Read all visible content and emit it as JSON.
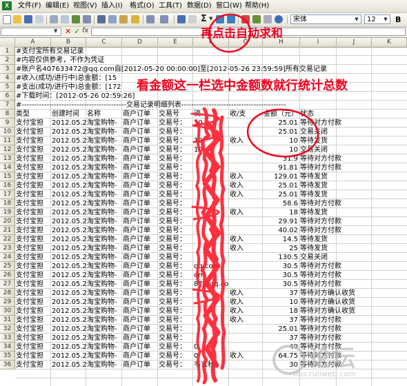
{
  "menu": {
    "items": [
      "文件(F)",
      "编辑(E)",
      "视图(V)",
      "插入(I)",
      "格式(O)",
      "工具(T)",
      "数据(D)",
      "窗口(W)",
      "帮助(H)"
    ]
  },
  "toolbar": {
    "sum_label": "Σ",
    "font_name": "宋体",
    "font_size": "12",
    "bold_label": "B"
  },
  "formula_bar": {
    "name_box": "",
    "cancel_symbol": "✕",
    "enter_symbol": "✓",
    "fx_label": "fx",
    "content": ""
  },
  "columns": [
    "A",
    "B",
    "C",
    "D",
    "E",
    "F",
    "G",
    "H",
    "I",
    "J",
    "K"
  ],
  "rows": [
    {
      "n": "1",
      "a": "#支付宝所有交易记录"
    },
    {
      "n": "2",
      "a": "#内容仅供参考，不作为凭证"
    },
    {
      "n": "3",
      "a": "#账户名407633472@qq.com自[2012-05-20 00:00:00]至[2012-05-26 23:59:59]所有交易记录"
    },
    {
      "n": "4",
      "a": "#收入(成功/进行中)总金额：[15"
    },
    {
      "n": "5",
      "a": "#支出(成功/进行中)总金额：[172"
    },
    {
      "n": "6",
      "a": "#下载时间：[2012-05-26 02:59:26]"
    },
    {
      "n": "7",
      "a": "#------------------------------------------交易记录明细列表------------------------------------------"
    },
    {
      "n": "8",
      "b": "创建时间",
      "c": "名称",
      "d": "商户订单",
      "e": "交易号",
      "f": "流",
      "g": "收/支",
      "h": "金额（元）",
      "i": "状态",
      "a": "类型"
    },
    {
      "n": "9",
      "a": "支付宝担",
      "b": "2012.05.2",
      "c": "淘宝购物-",
      "d": "商户订单",
      "e": "交易号：",
      "f": "10",
      "h": "25.01",
      "i": "等待对方付款"
    },
    {
      "n": "10",
      "a": "支付宝担",
      "b": "2012.05.2",
      "c": "淘宝购物-",
      "d": "商户订单",
      "e": "交易号：",
      "h": "25.01",
      "i": "交易关闭"
    },
    {
      "n": "11",
      "a": "支付宝担",
      "b": "2012.05.2",
      "c": "淘宝购物-",
      "d": "商户订单",
      "e": "交易号：",
      "f": "10",
      "g": "收入",
      "h": "10",
      "i": "等待发货"
    },
    {
      "n": "12",
      "a": "支付宝担",
      "b": "2012.05.2",
      "c": "淘宝购物-",
      "d": "商户订单",
      "e": "交易号：",
      "f": "10",
      "h": "10",
      "i": "交易关闭"
    },
    {
      "n": "13",
      "a": "支付宝担",
      "b": "2012.05.2",
      "c": "淘宝购物-",
      "d": "商户订单",
      "e": "交易号：",
      "h": "31.9",
      "i": "等待对方付款"
    },
    {
      "n": "14",
      "a": "支付宝担",
      "b": "2012.05.2",
      "c": "淘宝购物-",
      "d": "商户订单",
      "e": "交易号：",
      "h": "91.81",
      "i": "等待对方付款"
    },
    {
      "n": "15",
      "a": "支付宝担",
      "b": "2012.05.2",
      "c": "淘宝购物-",
      "d": "商户订单",
      "e": "交易号：",
      "g": "收入",
      "h": "129.01",
      "i": "等待发货"
    },
    {
      "n": "16",
      "a": "支付宝担",
      "b": "2012.05.2",
      "c": "淘宝购物-",
      "d": "商户订单",
      "e": "交易号：",
      "g": "收入",
      "h": "25.01",
      "i": "等待发货"
    },
    {
      "n": "17",
      "a": "支付宝担",
      "b": "2012.05.2",
      "c": "淘宝购物-",
      "d": "商户订单",
      "e": "交易号：",
      "g": "收入",
      "h": "25.01",
      "i": "等待发货"
    },
    {
      "n": "18",
      "a": "支付宝担",
      "b": "2012.05.2",
      "c": "淘宝购物-",
      "d": "商户订单",
      "e": "交易号：",
      "h": "58.6",
      "i": "等待对方付款"
    },
    {
      "n": "19",
      "a": "支付宝担",
      "b": "2012.05.2",
      "c": "淘宝购物-",
      "d": "商户订单",
      "e": "交易号：",
      "g": "收入",
      "h": "18",
      "i": "等待发货"
    },
    {
      "n": "20",
      "a": "支付宝担",
      "b": "2012.05.2",
      "c": "淘宝购物-",
      "d": "商户订单",
      "e": "交易号：",
      "h": "29.91",
      "i": "等待对方付款"
    },
    {
      "n": "21",
      "a": "支付宝担",
      "b": "2012.05.2",
      "c": "淘宝购物-",
      "d": "商户订单",
      "e": "交易号：",
      "h": "40.02",
      "i": "等待对方付款"
    },
    {
      "n": "22",
      "a": "支付宝担",
      "b": "2012.05.2",
      "c": "淘宝购物-",
      "d": "商户订单",
      "e": "交易号：",
      "g": "收入",
      "h": "14.5",
      "i": "等待发货"
    },
    {
      "n": "23",
      "a": "支付宝担",
      "b": "2012.05.2",
      "c": "淘宝购物-",
      "d": "商户订单",
      "e": "交易号：",
      "g": "收入",
      "h": "25",
      "i": "等待发货"
    },
    {
      "n": "24",
      "a": "支付宝担",
      "b": "2012.05.2",
      "c": "淘宝购物-",
      "d": "商户订单",
      "e": "交易号：",
      "h": "130.5",
      "i": "交易关闭"
    },
    {
      "n": "25",
      "a": "支付宝担",
      "b": "2012.05.2",
      "c": "淘宝购物-",
      "d": "商户订单",
      "e": "交易号：",
      "f": "qq.com",
      "h": "30.5",
      "i": "等待对方付款"
    },
    {
      "n": "26",
      "a": "支付宝担",
      "b": "2012.05.2",
      "c": "淘宝购物-",
      "d": "商户订单",
      "e": "交易号：",
      "f": "om",
      "h": "30.5",
      "i": "等待对方付款"
    },
    {
      "n": "27",
      "a": "支付宝担",
      "b": "2012.05.2",
      "c": "淘宝购物-",
      "d": "商户订单",
      "e": "交易号：",
      "f": "87@qq.com",
      "h": "30.5",
      "i": "等待对方付款"
    },
    {
      "n": "28",
      "a": "支付宝担",
      "b": "2012.05.2",
      "c": "淘宝购物-",
      "d": "商户订单",
      "e": "交易号：",
      "g": "收入",
      "h": "37",
      "i": "等待对方确认收货"
    },
    {
      "n": "29",
      "a": "支付宝担",
      "b": "2012.05.2",
      "c": "淘宝购物-",
      "d": "商户订单",
      "e": "交易号：",
      "g": "收入",
      "h": "10",
      "i": "等待对方确认收货"
    },
    {
      "n": "30",
      "a": "支付宝担",
      "b": "2012.05.2",
      "c": "淘宝购物-",
      "d": "商户订单",
      "e": "交易号：",
      "g": "收入",
      "h": "18",
      "i": "等待对方确认收货"
    },
    {
      "n": "31",
      "a": "支付宝担",
      "b": "2012.05.2",
      "c": "淘宝购物-",
      "d": "商户订单",
      "e": "交易号：",
      "g": "收入",
      "h": "37",
      "i": "等待对方付款"
    },
    {
      "n": "32",
      "a": "支付宝担",
      "b": "2012.05.2",
      "c": "淘宝购物-",
      "d": "商户订单",
      "e": "交易号：",
      "h": "25.01",
      "i": "等待对方付款"
    },
    {
      "n": "33",
      "a": "支付宝担",
      "b": "2012.05.2",
      "c": "淘宝购物-",
      "d": "商户订单",
      "e": "交易号：",
      "h": "37",
      "i": "等待对方付款"
    },
    {
      "n": "34",
      "a": "支付宝担",
      "b": "2012.05.2",
      "c": "淘宝购物-",
      "d": "商户订单",
      "e": "交易号：",
      "f": "0",
      "h": "49",
      "i": "等待对方付款"
    },
    {
      "n": "35",
      "a": "支付宝担",
      "b": "2012.05.2",
      "c": "淘宝购物-",
      "d": "商户订单",
      "e": "交易号：",
      "f": "0",
      "g": "收入",
      "h": "64.75",
      "i": "等待对方付款"
    },
    {
      "n": "36",
      "a": "支付宝担",
      "b": "2012.05.2",
      "c": "淘宝购物-",
      "d": "商户订单",
      "e": "交易号：",
      "f": "韦玄秋",
      "h": "30",
      "i": "等待对方付款"
    }
  ],
  "annotations": {
    "top": "再点击自动求和",
    "middle": "看金额这一栏选中金额数就行统计总数"
  },
  "watermark": {
    "text": "论坛",
    "url": "bbs.ruliweb.com"
  },
  "colors": {
    "annotation_red": "#f0001e",
    "scribble_red": "#ff2030"
  }
}
